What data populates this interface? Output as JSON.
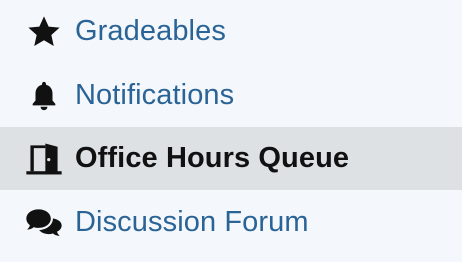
{
  "sidebar": {
    "items": [
      {
        "label": "Gradeables",
        "icon": "star-icon",
        "active": false
      },
      {
        "label": "Notifications",
        "icon": "bell-icon",
        "active": false
      },
      {
        "label": "Office Hours Queue",
        "icon": "door-open-icon",
        "active": true
      },
      {
        "label": "Discussion Forum",
        "icon": "comments-icon",
        "active": false
      }
    ]
  },
  "colors": {
    "link": "#2a6496",
    "active_text": "#111111",
    "active_background": "#dde1e4",
    "background": "#f4f7fb",
    "icon": "#111111"
  }
}
